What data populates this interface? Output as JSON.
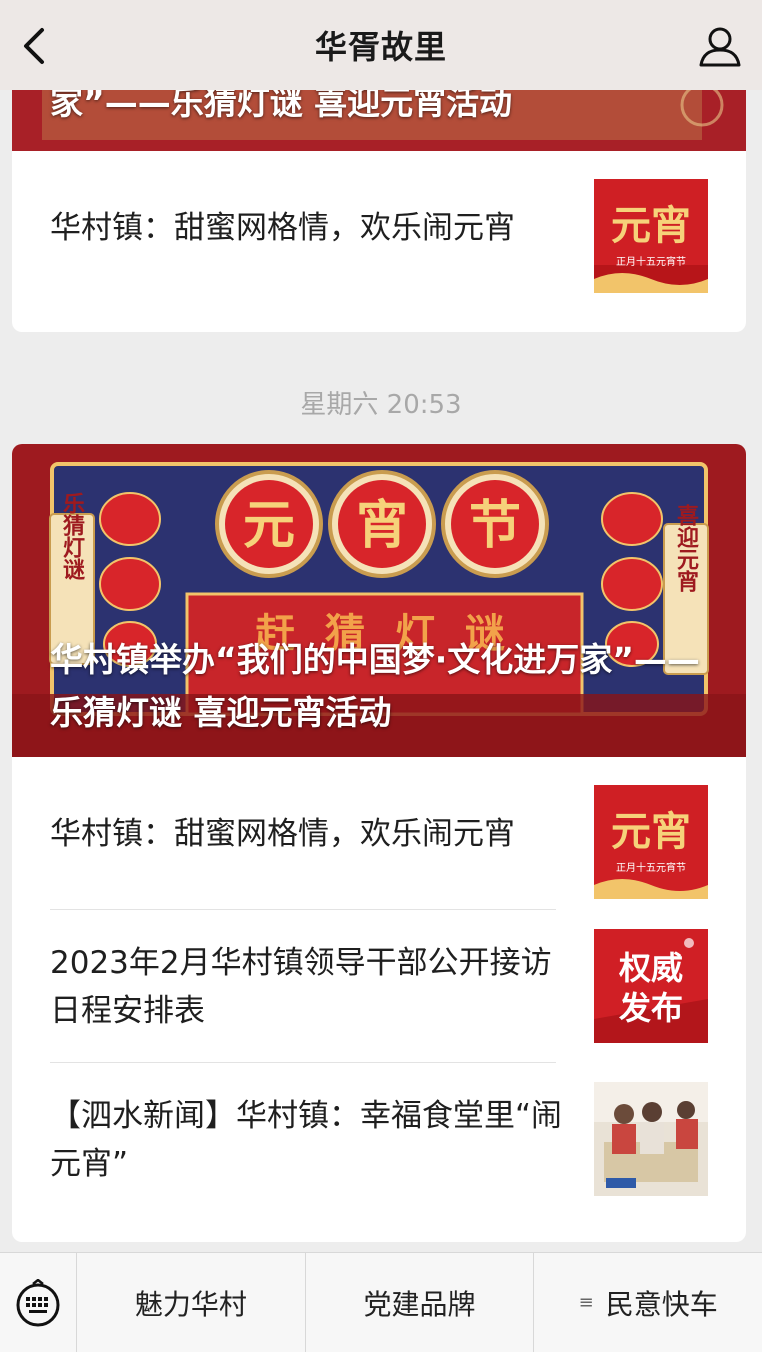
{
  "header": {
    "title": "华胥故里",
    "back_icon": "chevron-left-icon",
    "profile_icon": "person-icon"
  },
  "top_card": {
    "headline_tail": "家”——乐猜灯谜 喜迎元宵活动",
    "items": [
      {
        "title": "华村镇：甜蜜网格情，欢乐闹元宵"
      }
    ]
  },
  "timestamp": "星期六 20:53",
  "main_card": {
    "headline": "华村镇举办“我们的中国梦·文化进万家”——乐猜灯谜 喜迎元宵活动",
    "banner_text": {
      "big": [
        "元",
        "宵",
        "节"
      ],
      "left": "乐猜灯谜",
      "right": "喜迎元宵",
      "strip": "赶 猜 灯 谜"
    },
    "items": [
      {
        "title": "华村镇：甜蜜网格情，欢乐闹元宵"
      },
      {
        "title": "2023年2月华村镇领导干部公开接访日程安排表"
      },
      {
        "title": "【泗水新闻】华村镇：幸福食堂里“闹元宵”"
      }
    ]
  },
  "thumbs": {
    "yuanxiao": {
      "big": "元宵",
      "small": "正月十五元宵节"
    },
    "authority": {
      "line1": "权威",
      "line2": "发布"
    }
  },
  "bottom_menu": {
    "keyboard_icon": "keyboard-icon",
    "items": [
      "魅力华村",
      "党建品牌",
      "民意快车"
    ]
  },
  "colors": {
    "banner_red": "#9e1a1f",
    "gold": "#f2c46a",
    "navy": "#2c3270"
  }
}
